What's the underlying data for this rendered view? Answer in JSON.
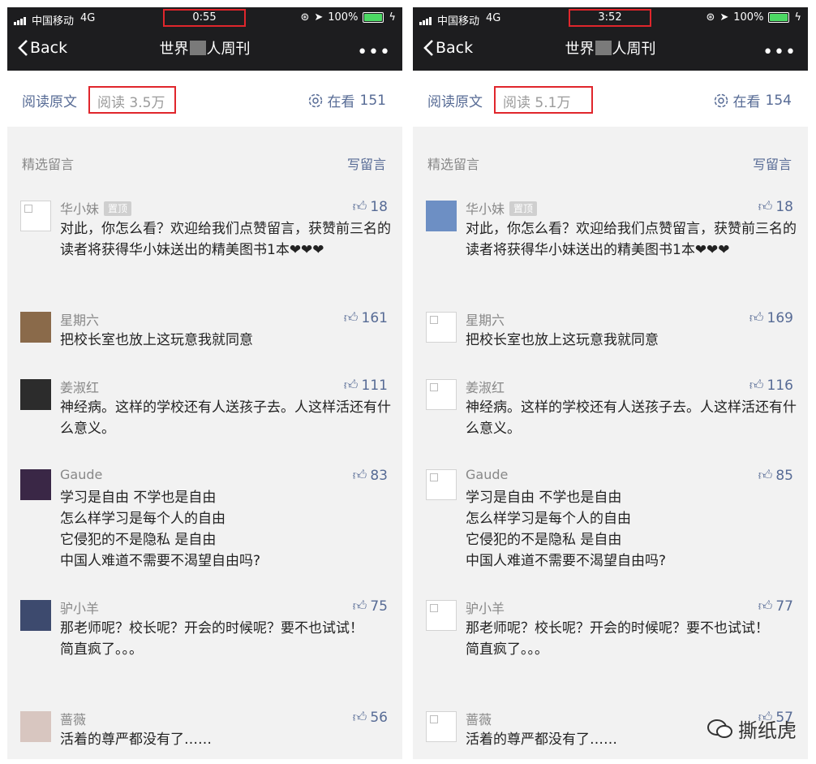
{
  "status_bar": {
    "carrier": "中国移动",
    "network": "4G",
    "battery": "100%"
  },
  "nav": {
    "back_label": "Back",
    "title_left": "世界",
    "title_right": "人周刊"
  },
  "article": {
    "read_original": "阅读原文",
    "watching_label": "在看"
  },
  "comments_header": {
    "title": "精选留言",
    "write": "写留言"
  },
  "pinned_badge": "置顶",
  "screens": [
    {
      "time": "0:55",
      "reads": "阅读 3.5万",
      "watching": "151",
      "comments": [
        {
          "nick": "华小妹",
          "pinned": true,
          "likes": "18",
          "text": "对此，你怎么看？欢迎给我们点赞留言，获赞前三名的读者将获得华小妹送出的精美图书1本❤❤❤"
        },
        {
          "nick": "星期六",
          "likes": "161",
          "text": "把校长室也放上这玩意我就同意"
        },
        {
          "nick": "姜淑红",
          "likes": "111",
          "text": "神经病。这样的学校还有人送孩子去。人这样活还有什么意义。"
        },
        {
          "nick": "Gaude",
          "likes": "83",
          "text": "学习是自由 不学也是自由\n怎么样学习是每个人的自由\n它侵犯的不是隐私 是自由\n中国人难道不需要不渴望自由吗?"
        },
        {
          "nick": "驴小羊",
          "likes": "75",
          "text": "那老师呢？校长呢？开会的时候呢？要不也试试！\n简直疯了。。。"
        },
        {
          "nick": "蔷薇",
          "likes": "56",
          "text": "活着的尊严都没有了……"
        }
      ]
    },
    {
      "time": "3:52",
      "reads": "阅读 5.1万",
      "watching": "154",
      "comments": [
        {
          "nick": "华小妹",
          "pinned": true,
          "likes": "18",
          "text": "对此，你怎么看？欢迎给我们点赞留言，获赞前三名的读者将获得华小妹送出的精美图书1本❤❤❤"
        },
        {
          "nick": "星期六",
          "likes": "169",
          "text": "把校长室也放上这玩意我就同意"
        },
        {
          "nick": "姜淑红",
          "likes": "116",
          "text": "神经病。这样的学校还有人送孩子去。人这样活还有什么意义。"
        },
        {
          "nick": "Gaude",
          "likes": "85",
          "text": "学习是自由 不学也是自由\n怎么样学习是每个人的自由\n它侵犯的不是隐私 是自由\n中国人难道不需要不渴望自由吗?"
        },
        {
          "nick": "驴小羊",
          "likes": "77",
          "text": "那老师呢？校长呢？开会的时候呢？要不也试试！\n简直疯了。。。"
        },
        {
          "nick": "蔷薇",
          "likes": "57",
          "text": "活着的尊严都没有了……"
        }
      ]
    }
  ],
  "watermark": "撕纸虎",
  "colors": {
    "link": "#576b95",
    "highlight_box": "#e0262c",
    "bar": "#1d1d1f"
  }
}
